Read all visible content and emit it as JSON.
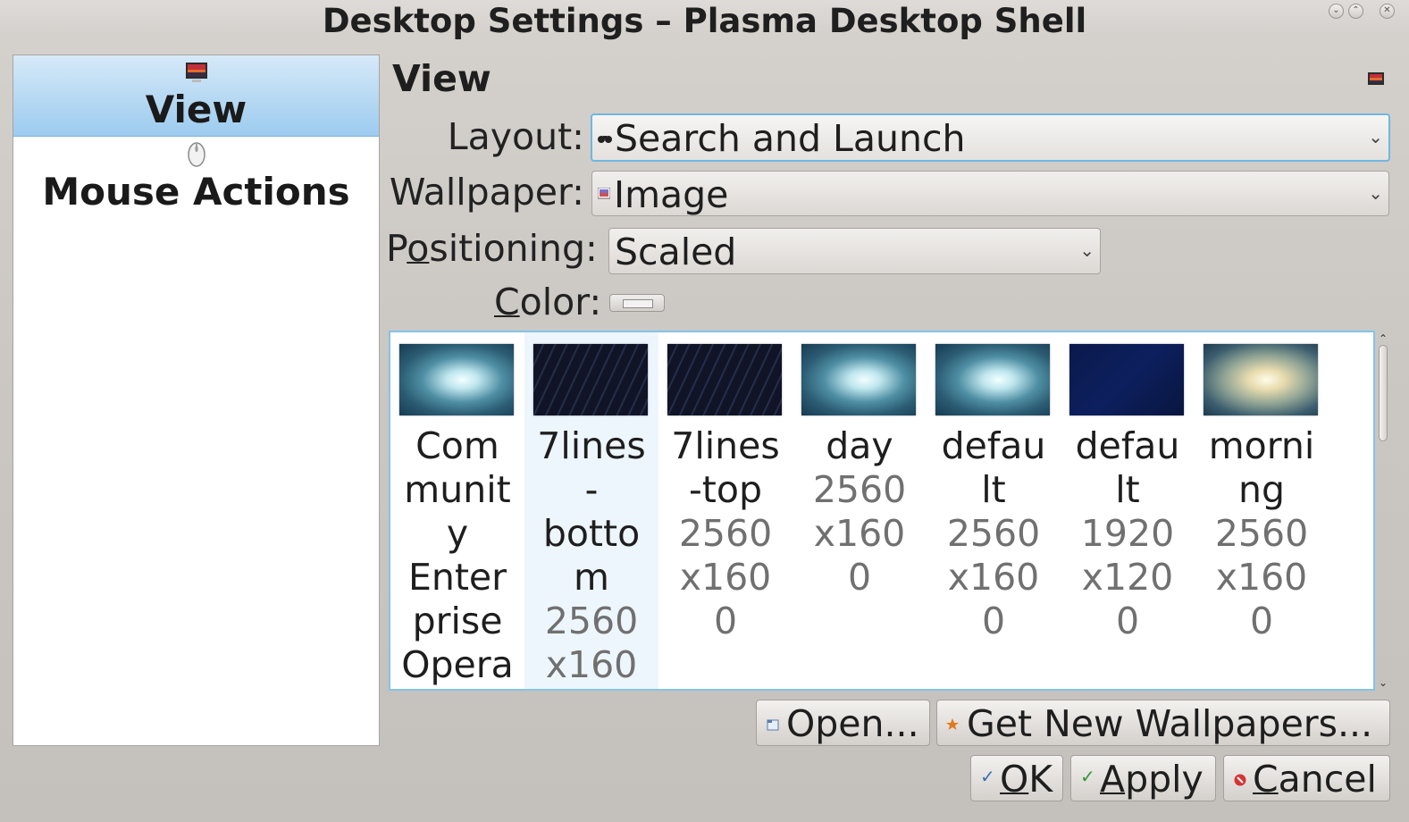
{
  "window": {
    "title": "Desktop Settings – Plasma Desktop Shell",
    "controls": [
      "minimize",
      "maximize",
      "close"
    ]
  },
  "sidebar": {
    "items": [
      {
        "label": "View",
        "icon": "desktop-image-icon",
        "selected": true
      },
      {
        "label": "Mouse Actions",
        "icon": "mouse-icon",
        "selected": false
      }
    ]
  },
  "page": {
    "title": "View",
    "layout_label": "Layout:",
    "layout_value": "Search and Launch",
    "wallpaper_label": "Wallpaper:",
    "wallpaper_value": "Image",
    "positioning_label_pre": "P",
    "positioning_label_ul": "o",
    "positioning_label_post": "sitioning:",
    "positioning_value": "Scaled",
    "color_label_ul": "C",
    "color_label_post": "olor:",
    "color_value": "#f2f2f2"
  },
  "wallpapers": [
    {
      "name": "Community Enterprise Opera",
      "resolution": "",
      "selected": false,
      "theme": "teal"
    },
    {
      "name": "7lines-bottom",
      "resolution": "2560x160",
      "selected": true,
      "theme": "dark-lines"
    },
    {
      "name": "7lines-top",
      "resolution": "2560x1600",
      "selected": false,
      "theme": "dark-lines"
    },
    {
      "name": "day",
      "resolution": "2560x1600",
      "selected": false,
      "theme": "teal"
    },
    {
      "name": "default",
      "resolution": "2560x1600",
      "selected": false,
      "theme": "teal"
    },
    {
      "name": "default",
      "resolution": "1920x1200",
      "selected": false,
      "theme": "navy"
    },
    {
      "name": "morning",
      "resolution": "2560x1600",
      "selected": false,
      "theme": "warm"
    }
  ],
  "wallpaper_rows": [
    {
      "name_lines": [
        "Com",
        "munit",
        "y",
        "Enter",
        "prise",
        "Opera"
      ],
      "res_lines": []
    },
    {
      "name_lines": [
        "7lines",
        "-",
        "botto",
        "m"
      ],
      "res_lines": [
        "2560",
        "x160"
      ]
    },
    {
      "name_lines": [
        "7lines",
        "-top"
      ],
      "res_lines": [
        "2560",
        "x160",
        "0"
      ]
    },
    {
      "name_lines": [
        "day"
      ],
      "res_lines": [
        "2560",
        "x160",
        "0"
      ]
    },
    {
      "name_lines": [
        "defau",
        "lt"
      ],
      "res_lines": [
        "2560",
        "x160",
        "0"
      ]
    },
    {
      "name_lines": [
        "defau",
        "lt"
      ],
      "res_lines": [
        "1920",
        "x120",
        "0"
      ]
    },
    {
      "name_lines": [
        "morni",
        "ng"
      ],
      "res_lines": [
        "2560",
        "x160",
        "0"
      ]
    }
  ],
  "actions": {
    "open_label": "Open...",
    "get_new_label": "Get New Wallpapers..."
  },
  "dialog_buttons": {
    "ok_ul": "O",
    "ok_rest": "K",
    "apply_ul": "A",
    "apply_rest": "pply",
    "cancel_ul": "C",
    "cancel_rest": "ancel"
  },
  "colors": {
    "selection_blue": "#9ccbef",
    "focus_border": "#6fb7e2"
  }
}
